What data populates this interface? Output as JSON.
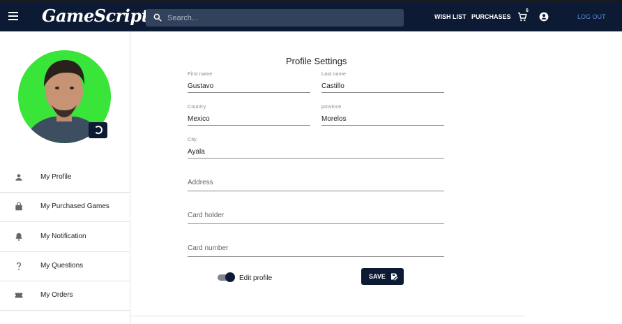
{
  "header": {
    "logo_text": "GameScript",
    "search_placeholder": "Search...",
    "wishlist_label": "WISH LIST",
    "purchases_label": "PURCHASES",
    "cart_count": "6",
    "logout_label": "LOG OUT",
    "icons": {
      "menu": "menu-icon",
      "search": "search-icon",
      "cart": "cart-icon",
      "account": "account-icon"
    },
    "colors": {
      "bar": "#0d1a33",
      "search_bg": "#33425c",
      "logout": "#5a8ad6"
    }
  },
  "sidebar": {
    "avatar_bg": "#3ae53a",
    "items": [
      {
        "label": "My Profile",
        "icon": "person-icon"
      },
      {
        "label": "My Purchased Games",
        "icon": "shopping-bag-icon"
      },
      {
        "label": "My Notification",
        "icon": "bell-icon"
      },
      {
        "label": "My Questions",
        "icon": "question-icon"
      },
      {
        "label": "My Orders",
        "icon": "ticket-icon"
      }
    ]
  },
  "form": {
    "title": "Profile Settings",
    "first_name": {
      "label": "First name",
      "value": "Gustavo"
    },
    "last_name": {
      "label": "Last name",
      "value": "Castillo"
    },
    "country": {
      "label": "Country",
      "value": "Mexico"
    },
    "province": {
      "label": "province",
      "value": "Morelos"
    },
    "city": {
      "label": "City",
      "value": "Ayala"
    },
    "address": {
      "placeholder": "Address"
    },
    "card_holder": {
      "placeholder": "Card holder"
    },
    "card_number": {
      "placeholder": "Card number"
    },
    "edit_profile_label": "Edit profile",
    "edit_profile_on": true,
    "save_label": "SAVE"
  }
}
